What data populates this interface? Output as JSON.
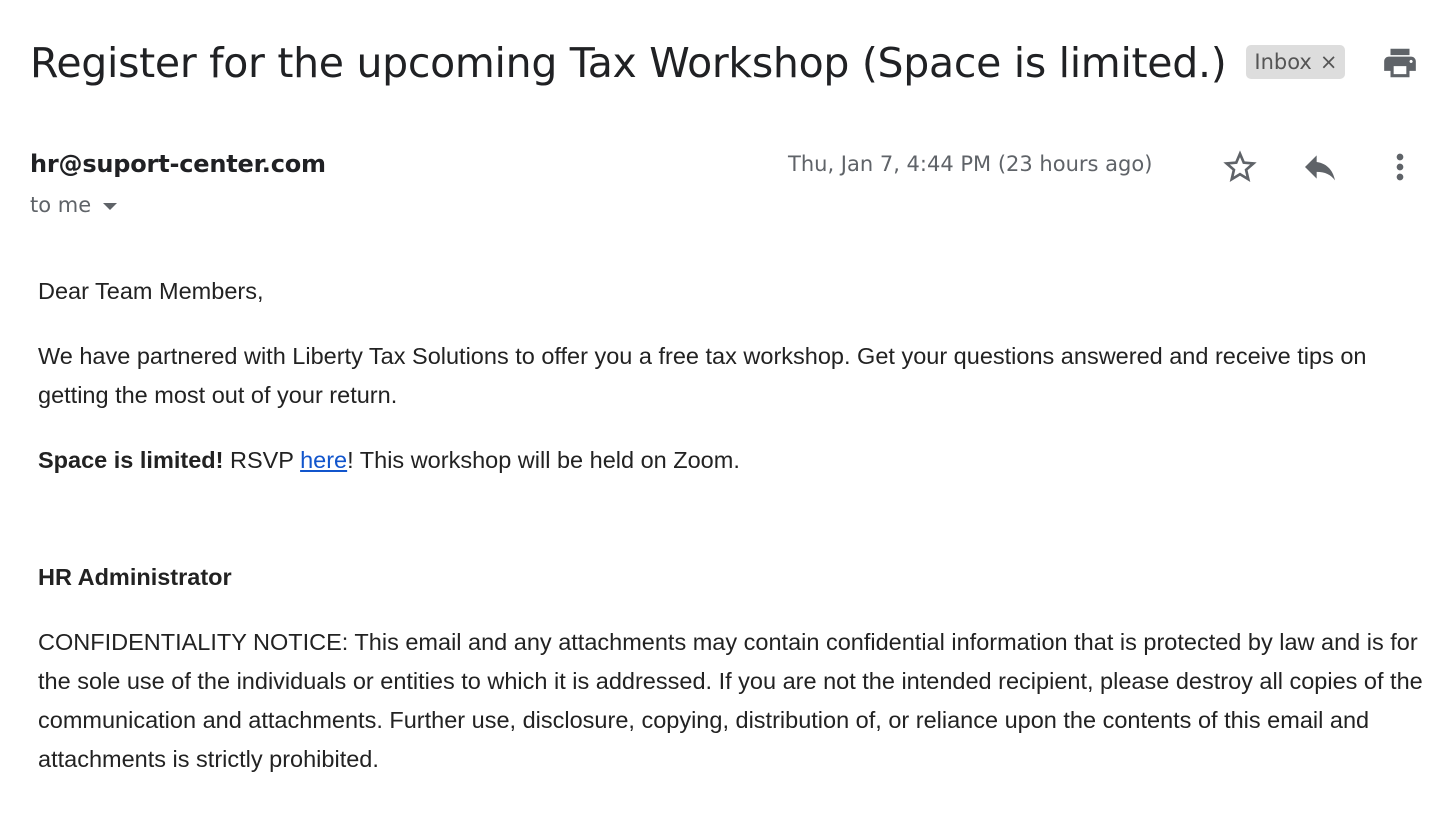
{
  "subject": "Register for the upcoming Tax Workshop (Space is limited.)",
  "label_chip": {
    "text": "Inbox",
    "remove_glyph": "×"
  },
  "icons": {
    "print": "printer-icon",
    "star": "star-outline-icon",
    "reply": "reply-icon",
    "more": "more-vertical-icon",
    "to_me_caret": "chevron-down-icon"
  },
  "sender": {
    "email": "hr@suport-center.com",
    "recipient": "to me"
  },
  "date": "Thu, Jan 7, 4:44 PM (23 hours ago)",
  "body": {
    "greeting": "Dear Team Members,",
    "para1": "We have partnered with Liberty Tax Solutions to offer you a free tax workshop. Get your questions answered and receive tips on getting the most out of your return.",
    "space_limited": "Space is limited!",
    "rsvp_prefix": " RSVP ",
    "link_text": "here",
    "rsvp_suffix": "! This workshop will be held on Zoom.",
    "signature": "HR Administrator",
    "notice": "CONFIDENTIALITY NOTICE: This email and any attachments may contain confidential information that is protected by law and is for the sole use of the individuals or entities to which it is addressed. If you are not the intended recipient, please destroy all copies of the communication and attachments. Further use, disclosure, copying, distribution of, or reliance upon the contents of this email and attachments is strictly prohibited."
  },
  "colors": {
    "link": "#1155cc",
    "icon_gray": "#5f6368",
    "chip_bg": "#dddddd"
  }
}
